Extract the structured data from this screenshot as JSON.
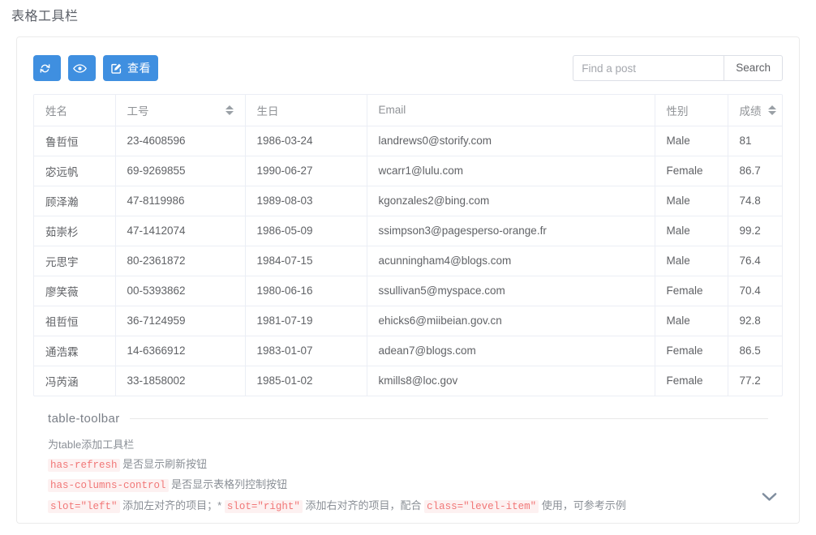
{
  "page_title": "表格工具栏",
  "toolbar": {
    "refresh_button": {
      "icon": "refresh-icon",
      "label": ""
    },
    "columns_button": {
      "icon": "eye-icon",
      "label": ""
    },
    "view_button": {
      "icon": "edit-square-icon",
      "label": "查看"
    },
    "search": {
      "placeholder": "Find a post",
      "value": "",
      "button_label": "Search"
    }
  },
  "table": {
    "columns": [
      {
        "key": "name",
        "label": "姓名",
        "sortable": false
      },
      {
        "key": "id",
        "label": "工号",
        "sortable": true
      },
      {
        "key": "bday",
        "label": "生日",
        "sortable": false
      },
      {
        "key": "email",
        "label": "Email",
        "sortable": false
      },
      {
        "key": "sex",
        "label": "性别",
        "sortable": false
      },
      {
        "key": "score",
        "label": "成绩",
        "sortable": true
      }
    ],
    "rows": [
      {
        "name": "鲁哲恒",
        "id": "23-4608596",
        "bday": "1986-03-24",
        "email": "landrews0@storify.com",
        "sex": "Male",
        "score": "81"
      },
      {
        "name": "宓远帆",
        "id": "69-9269855",
        "bday": "1990-06-27",
        "email": "wcarr1@lulu.com",
        "sex": "Female",
        "score": "86.7"
      },
      {
        "name": "顾泽瀚",
        "id": "47-8119986",
        "bday": "1989-08-03",
        "email": "kgonzales2@bing.com",
        "sex": "Male",
        "score": "74.8"
      },
      {
        "name": "茹崇杉",
        "id": "47-1412074",
        "bday": "1986-05-09",
        "email": "ssimpson3@pagesperso-orange.fr",
        "sex": "Male",
        "score": "99.2"
      },
      {
        "name": "元思宇",
        "id": "80-2361872",
        "bday": "1984-07-15",
        "email": "acunningham4@blogs.com",
        "sex": "Male",
        "score": "76.4"
      },
      {
        "name": "廖笑薇",
        "id": "00-5393862",
        "bday": "1980-06-16",
        "email": "ssullivan5@myspace.com",
        "sex": "Female",
        "score": "70.4"
      },
      {
        "name": "祖哲恒",
        "id": "36-7124959",
        "bday": "1981-07-19",
        "email": "ehicks6@miibeian.gov.cn",
        "sex": "Male",
        "score": "92.8"
      },
      {
        "name": "通浩霖",
        "id": "14-6366912",
        "bday": "1983-01-07",
        "email": "adean7@blogs.com",
        "sex": "Female",
        "score": "86.5"
      },
      {
        "name": "冯芮涵",
        "id": "33-1858002",
        "bday": "1985-01-02",
        "email": "kmills8@loc.gov",
        "sex": "Female",
        "score": "77.2"
      }
    ]
  },
  "docs": {
    "legend": "table-toolbar",
    "line1": "为table添加工具栏",
    "line2": {
      "code": "has-refresh",
      "text": "是否显示刷新按钮"
    },
    "line3": {
      "code": "has-columns-control",
      "text": "是否显示表格列控制按钮"
    },
    "line4": {
      "code1": "slot=\"left\"",
      "text1": "添加左对齐的项目；*",
      "code2": "slot=\"right\"",
      "text2": "添加右对齐的项目，配合",
      "code3": "class=\"level-item\"",
      "text3": "使用，可参考示例"
    },
    "expand_icon": "chevron-down-icon"
  },
  "colors": {
    "accent": "#3f8fe0",
    "code_token": "#f17777",
    "border": "#ebeef5",
    "text": "#606266"
  }
}
